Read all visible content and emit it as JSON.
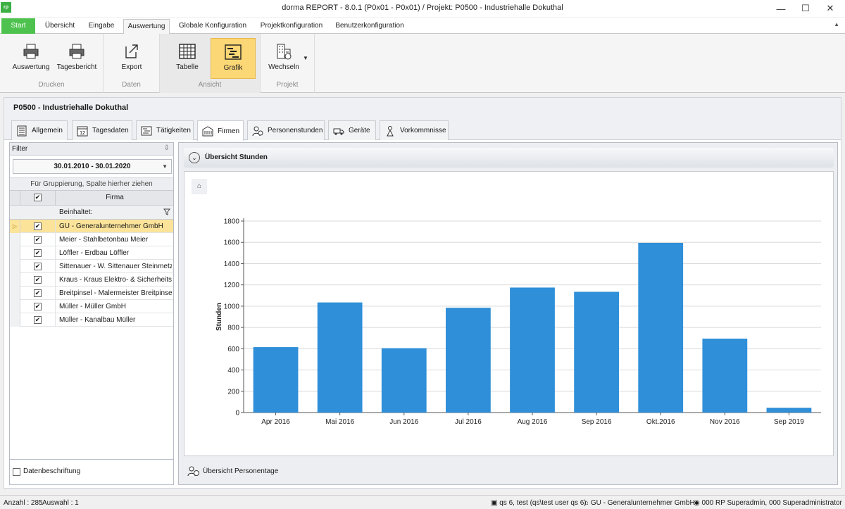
{
  "window": {
    "title": "dorma REPORT - 8.0.1 (P0x01 - P0x01) / Projekt: P0500  - Industriehalle Dokuthal",
    "logo_text": "rp"
  },
  "ribbon": {
    "tabs": [
      "Start",
      "Übersicht",
      "Eingabe",
      "Auswertung",
      "Globale Konfiguration",
      "Projektkonfiguration",
      "Benutzerkonfiguration"
    ],
    "active_tab": "Auswertung",
    "groups": {
      "drucken": {
        "label": "Drucken",
        "buttons": [
          "Auswertung",
          "Tagesbericht"
        ]
      },
      "daten": {
        "label": "Daten",
        "buttons": [
          "Export"
        ]
      },
      "ansicht": {
        "label": "Ansicht",
        "buttons": [
          "Tabelle",
          "Grafik"
        ]
      },
      "projekt": {
        "label": "Projekt",
        "buttons": [
          "Wechseln"
        ]
      }
    },
    "active_button": "Grafik"
  },
  "project": {
    "title": "P0500  - Industriehalle Dokuthal",
    "tabs": [
      "Allgemein",
      "Tagesdaten",
      "Tätigkeiten",
      "Firmen",
      "Personenstunden",
      "Geräte",
      "Vorkommnisse"
    ],
    "active_tab": "Firmen"
  },
  "filter": {
    "title": "Filter",
    "date_range": "30.01.2010 - 30.01.2020",
    "group_hint": "Für Gruppierung, Spalte hierher ziehen",
    "column_header": "Firma",
    "filter_label": "Beinhaltet:",
    "rows": [
      "GU - Generalunternehmer GmbH",
      "Meier - Stahlbetonbau Meier",
      "Löffler - Erdbau Löffler",
      "Sittenauer - W. Sittenauer Steinmetz...",
      "Kraus - Kraus Elektro- & Sicherheitst...",
      "Breitpinsel - Malermeister Breitpinsel",
      "Müller - Müller GmbH",
      "Müller - Kanalbau Müller"
    ],
    "selected_row": 0,
    "footer_checkbox": "Datenbeschriftung"
  },
  "chart_panel": {
    "header": "Übersicht Stunden",
    "footer": "Übersicht Personentage"
  },
  "chart_data": {
    "type": "bar",
    "categories": [
      "Apr 2016",
      "Mai 2016",
      "Jun 2016",
      "Jul 2016",
      "Aug 2016",
      "Sep 2016",
      "Okt.2016",
      "Nov 2016",
      "Sep 2019"
    ],
    "values": [
      615,
      1035,
      605,
      985,
      1175,
      1135,
      1595,
      695,
      45
    ],
    "ylabel": "Stunden",
    "ylim": [
      0,
      1800
    ],
    "yticks": [
      0,
      200,
      400,
      600,
      800,
      1000,
      1200,
      1400,
      1600,
      1800
    ],
    "grid": true,
    "color": "#2f8fd8"
  },
  "statusbar": {
    "count": "Anzahl : 285",
    "selection": "Auswahl : 1",
    "user": "qs 6, test (qs\\test user qs 6)",
    "company": "GU - Generalunternehmer GmbH",
    "admin": "000 RP Superadmin, 000 Superadministrator"
  }
}
